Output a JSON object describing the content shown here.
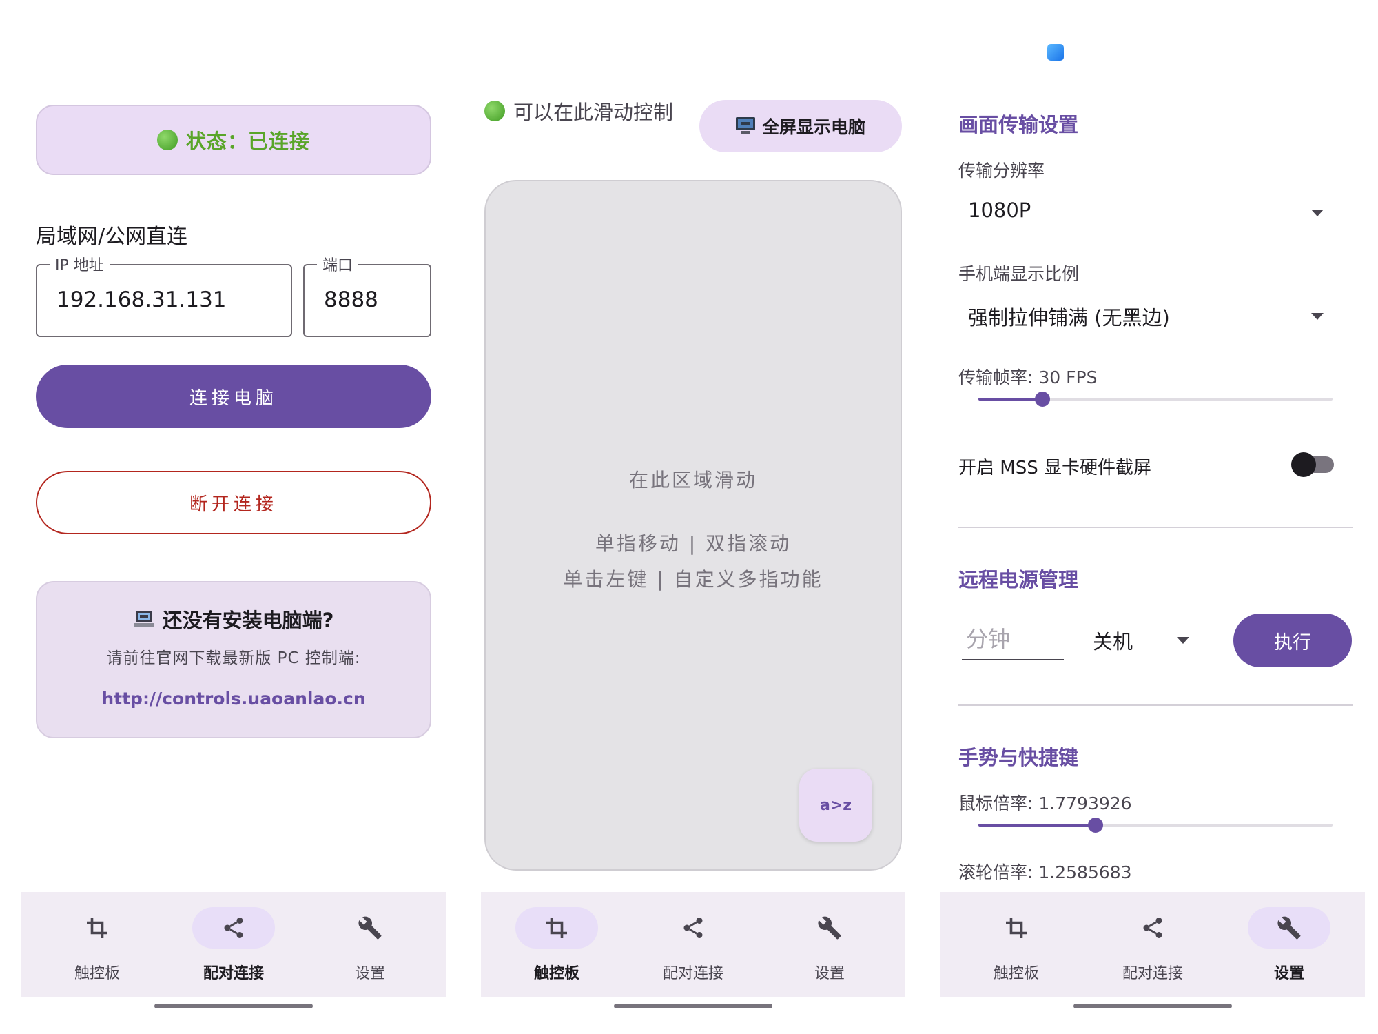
{
  "connection": {
    "status_label": "状态：已连接",
    "section_label": "局域网/公网直连",
    "ip_legend": "IP 地址",
    "ip_value": "192.168.31.131",
    "port_legend": "端口",
    "port_value": "8888",
    "connect_label": "连接电脑",
    "disconnect_label": "断开连接",
    "install_title": "还没有安装电脑端?",
    "install_desc": "请前往官网下载最新版 PC 控制端:",
    "install_link": "http://controls.uaoanlao.cn"
  },
  "touchpad": {
    "hint": "可以在此滑动控制",
    "fullscreen_label": "全屏显示电脑",
    "area_title": "在此区域滑动",
    "area_line1": "单指移动 | 双指滚动",
    "area_line2": "单击左键 | 自定义多指功能",
    "fab_label": "a>z"
  },
  "settings": {
    "screen_section": "画面传输设置",
    "resolution_label": "传输分辨率",
    "resolution_value": "1080P",
    "ratio_label": "手机端显示比例",
    "ratio_value": "强制拉伸铺满 (无黑边)",
    "fps_label": "传输帧率: 30 FPS",
    "fps_fraction": 0.18,
    "mss_label": "开启 MSS 显卡硬件截屏",
    "mss_enabled": false,
    "power_section": "远程电源管理",
    "minutes_placeholder": "分钟",
    "power_action": "关机",
    "execute_label": "执行",
    "gesture_section": "手势与快捷键",
    "mouse_label": "鼠标倍率: 1.7793926",
    "mouse_fraction": 0.33,
    "wheel_label": "滚轮倍率: 1.2585683"
  },
  "nav": {
    "touchpad": "触控板",
    "pair": "配对连接",
    "settings": "设置"
  },
  "colors": {
    "primary": "#684ea3",
    "tonal": "#eadcf5",
    "error": "#b3261e",
    "status_green": "#5aa52a"
  }
}
